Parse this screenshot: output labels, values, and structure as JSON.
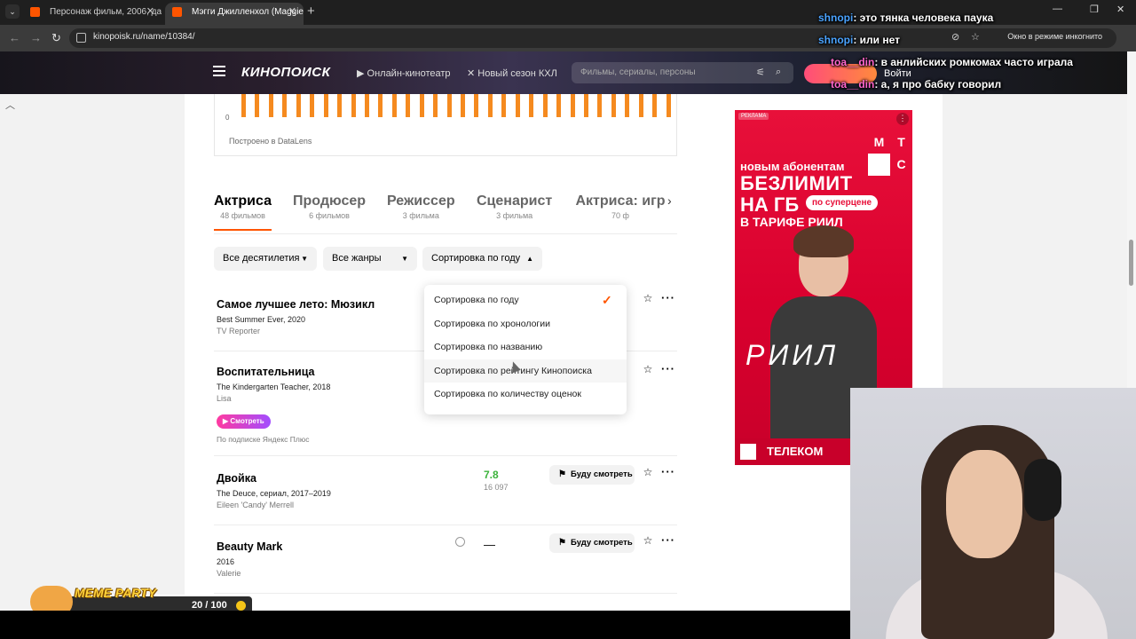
{
  "browser": {
    "tabs": [
      {
        "title": "Персонаж фильм, 2006, дата с",
        "active": false
      },
      {
        "title": "Мэгги Джилленхол (Maggie G",
        "active": true
      }
    ],
    "url": "kinopoisk.ru/name/10384/",
    "incognito_label": "Окно в режиме инкогнито"
  },
  "site_header": {
    "logo": "КИНОПОИСК",
    "nav": [
      "Онлайн-кинотеатр",
      "Новый сезон КХЛ"
    ],
    "search_placeholder": "Фильмы, сериалы, персоны",
    "trial_label": "Смотреть 30 дней бесплатно",
    "login_label": "Войти"
  },
  "chart": {
    "zero_label": "0",
    "credit": "Построено в DataLens",
    "bar_color": "#f58a1f"
  },
  "role_tabs": [
    {
      "name": "Актриса",
      "count": "48 фильмов",
      "active": true
    },
    {
      "name": "Продюсер",
      "count": "6 фильмов",
      "active": false
    },
    {
      "name": "Режиссер",
      "count": "3 фильма",
      "active": false
    },
    {
      "name": "Сценарист",
      "count": "3 фильма",
      "active": false
    },
    {
      "name": "Актриса: игр",
      "count": "70 ф",
      "active": false
    }
  ],
  "filters": {
    "decades": "Все десятилетия",
    "genres": "Все жанры",
    "sort": "Сортировка по году"
  },
  "sort_options": [
    "Сортировка по году",
    "Сортировка по хронологии",
    "Сортировка по названию",
    "Сортировка по рейтингу Кинопоиска",
    "Сортировка по количеству оценок"
  ],
  "films": [
    {
      "title": "Самое лучшее лето: Мюзикл",
      "orig": "Best Summer Ever, 2020",
      "role": "TV Reporter"
    },
    {
      "title": "Воспитательница",
      "orig": "The Kindergarten Teacher, 2018",
      "role": "Lisa",
      "play_label": "Смотреть",
      "sub_note": "По подписке Яндекс Плюс"
    },
    {
      "title": "Двойка",
      "orig": "The Deuce, сериал, 2017–2019",
      "role": "Eileen 'Candy' Merrell",
      "rating": "7.8",
      "votes": "16 097",
      "watch_label": "Буду смотреть"
    },
    {
      "title": "Beauty Mark",
      "orig": "2016",
      "role": "Valerie",
      "rating_dash": "—",
      "watch_label": "Буду смотреть"
    }
  ],
  "ad": {
    "tag": "РЕКЛАМА",
    "brand_letters": [
      "М",
      "Т",
      "С"
    ],
    "line1": "новым абонентам",
    "big1": "БЕЗЛИМИТ",
    "big2": "НА ГБ",
    "pill": "по суперцене",
    "line3": "В ТАРИФЕ РИИЛ",
    "script": "РИИЛ",
    "footer": "ТЕЛЕКОМ",
    "colors": {
      "primary": "#e8103a"
    }
  },
  "chat": [
    {
      "user": "shnopi",
      "text": ": это тянка человека паука"
    },
    {
      "user": "shnopi",
      "text": ": или нет"
    },
    {
      "user": "toa__din",
      "text": ": в анлийских ромкомах часто играла"
    },
    {
      "user": "toa__din",
      "text": ": а, я про бабку говорил"
    }
  ],
  "meme_party": {
    "title": "MEME PARTY",
    "score": "20 / 100"
  },
  "colors": {
    "accent": "#ff5500",
    "rating_green": "#3bb33b"
  }
}
